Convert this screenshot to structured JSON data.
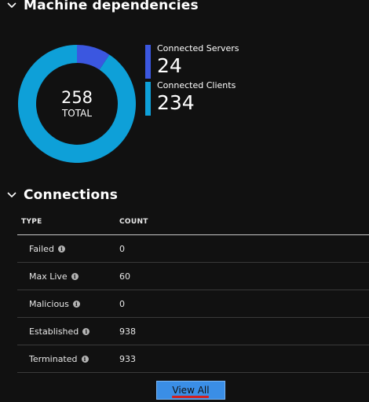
{
  "dependencies": {
    "title": "Machine dependencies",
    "total": "258",
    "total_label": "TOTAL",
    "legend": [
      {
        "label": "Connected Servers",
        "value": "24",
        "color": "#3b57e0"
      },
      {
        "label": "Connected Clients",
        "value": "234",
        "color": "#0ea0d8"
      }
    ],
    "chart_data": {
      "type": "pie",
      "categories": [
        "Connected Servers",
        "Connected Clients"
      ],
      "values": [
        24,
        234
      ],
      "colors": [
        "#3b57e0",
        "#0ea0d8"
      ]
    }
  },
  "connections": {
    "title": "Connections",
    "columns": [
      "TYPE",
      "COUNT"
    ],
    "rows": [
      {
        "type": "Failed",
        "count": "0"
      },
      {
        "type": "Max Live",
        "count": "60"
      },
      {
        "type": "Malicious",
        "count": "0"
      },
      {
        "type": "Established",
        "count": "938"
      },
      {
        "type": "Terminated",
        "count": "933"
      }
    ],
    "view_all_label": "View All"
  },
  "icons": {
    "chevron": "chevron-down-icon",
    "info": "info-icon"
  }
}
